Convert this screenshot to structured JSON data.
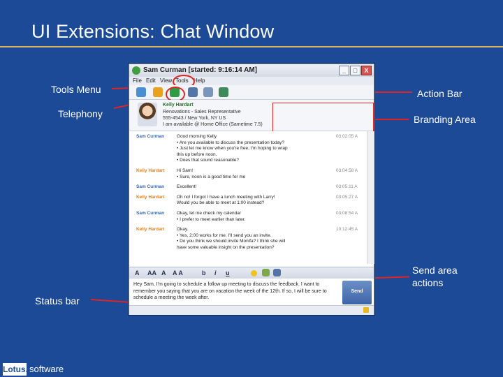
{
  "slide": {
    "title": "UI Extensions: Chat Window",
    "callouts": {
      "tools_menu": "Tools Menu",
      "telephony": "Telephony",
      "status_bar": "Status bar",
      "action_bar": "Action Bar",
      "branding_area": "Branding Area",
      "send_area": "Send area actions"
    },
    "logo": {
      "brand": "Lotus.",
      "product": "software"
    }
  },
  "window": {
    "title": "Sam Curman [started: 9:16:14 AM]",
    "controls": [
      "_",
      "□",
      "X"
    ],
    "menu": [
      "File",
      "Edit",
      "View",
      "Tools",
      "Help"
    ]
  },
  "branding": {
    "name": "Kelly Hardart",
    "role": "Renovations - Sales Representative",
    "phone": "555-4543 / New York, NY US",
    "status": "I am available @ Home Office (Sametime 7.5)"
  },
  "transcript": [
    {
      "sender": "Sam Curman",
      "who": "sam",
      "time": "03:02:05 A",
      "lines": [
        "Good morning Kelly",
        "• Are you available to discuss the presentation today?",
        "• Just let me know when you're free, I'm hoping to wrap",
        "  this up before noon.",
        "• Does that sound reasonable?"
      ]
    },
    {
      "sender": "Kelly Hardart",
      "who": "kelly",
      "time": "03:04:58 A",
      "lines": [
        "Hi Sam!",
        "• Sure, noon is a good time for me"
      ]
    },
    {
      "sender": "Sam Curman",
      "who": "sam",
      "time": "03:05:11 A",
      "lines": [
        "Excellent!"
      ]
    },
    {
      "sender": "Kelly Hardart",
      "who": "kelly",
      "time": "03:05:27 A",
      "lines": [
        "Oh no! I forgot I have a lunch meeting with Larry!",
        "Would you be able to meet at 1:00 instead?"
      ]
    },
    {
      "sender": "Sam Curman",
      "who": "sam",
      "time": "03:08:54 A",
      "lines": [
        "Okay, let me check my calendar",
        "• I prefer to meet earlier than later."
      ]
    },
    {
      "sender": "Kelly Hardart",
      "who": "kelly",
      "time": "10:12:45 A",
      "lines": [
        "Okay.",
        "• Yes, 2:00 works for me. I'll send you an invite.",
        "• Do you think we should invite Monifa? I think she will",
        "  have some valuable insight on the presentation?"
      ]
    }
  ],
  "formatbar": {
    "buttons": [
      "A",
      "AA",
      "A",
      "A A",
      "b",
      "i",
      "u"
    ]
  },
  "send": {
    "draft": "Hey Sam, I'm going to schedule a follow up meeting to discuss the feedback. I want to remember you saying that you are on vacation the week of the 12th. If so, I will be sure to schedule a meeting the week after.",
    "button": "Send"
  }
}
